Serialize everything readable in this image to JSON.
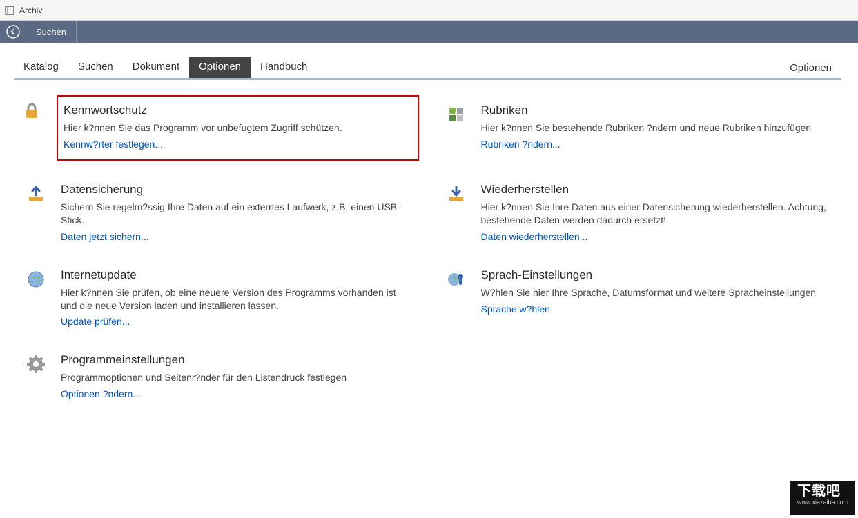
{
  "window": {
    "title": "Archiv"
  },
  "navbar": {
    "search": "Suchen"
  },
  "tabs": {
    "items": [
      "Katalog",
      "Suchen",
      "Dokument",
      "Optionen",
      "Handbuch"
    ],
    "active_index": 3,
    "right_label": "Optionen"
  },
  "cards": [
    {
      "icon": "lock",
      "title": "Kennwortschutz",
      "desc": "Hier k?nnen Sie das Programm vor unbefugtem Zugriff schützen.",
      "link": "Kennw?rter festlegen...",
      "highlight": true
    },
    {
      "icon": "categories",
      "title": "Rubriken",
      "desc": "Hier k?nnen Sie bestehende Rubriken ?ndern und neue Rubriken hinzufügen",
      "link": "Rubriken ?ndern..."
    },
    {
      "icon": "backup",
      "title": "Datensicherung",
      "desc": "Sichern Sie regelm?ssig Ihre Daten auf ein externes Laufwerk, z.B. einen USB-Stick.",
      "link": "Daten jetzt sichern..."
    },
    {
      "icon": "restore",
      "title": "Wiederherstellen",
      "desc": "Hier k?nnen Sie Ihre Daten aus einer Datensicherung wiederherstellen. Achtung, bestehende Daten werden dadurch ersetzt!",
      "link": "Daten wiederherstellen..."
    },
    {
      "icon": "globe",
      "title": "Internetupdate",
      "desc": "Hier k?nnen Sie prüfen, ob eine neuere Version des Programms vorhanden ist und die neue Version laden und installieren lassen.",
      "link": "Update prüfen..."
    },
    {
      "icon": "language",
      "title": "Sprach-Einstellungen",
      "desc": "W?hlen Sie hier Ihre Sprache, Datumsformat und weitere Spracheinstellungen",
      "link": "Sprache w?hlen"
    },
    {
      "icon": "gear",
      "title": "Programmeinstellungen",
      "desc": "Programmoptionen und Seitenr?nder für den Listendruck festlegen",
      "link": "Optionen ?ndern..."
    }
  ],
  "watermark": {
    "text": "下载吧",
    "url": "www.xiazaiba.com"
  }
}
